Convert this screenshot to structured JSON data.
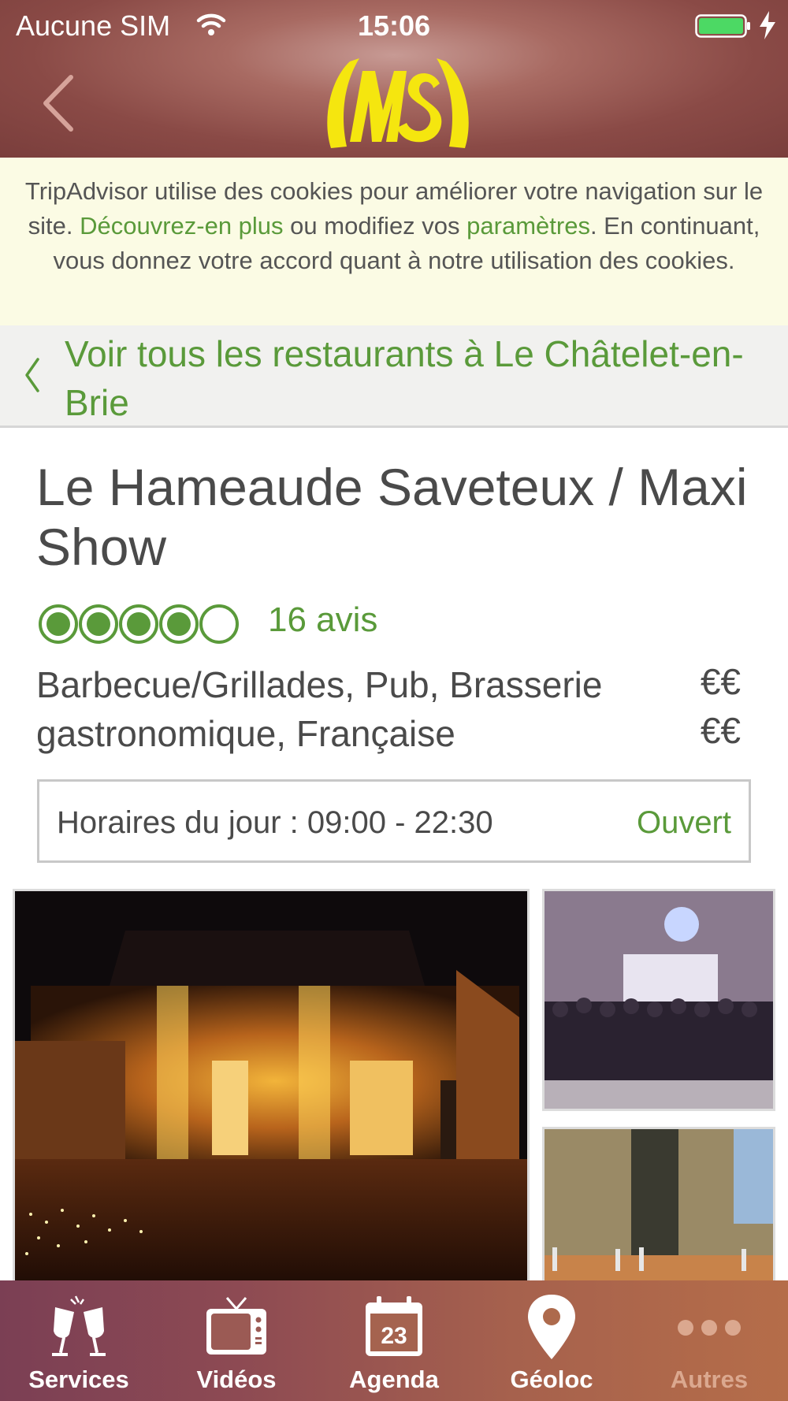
{
  "status": {
    "carrier": "Aucune SIM",
    "time": "15:06"
  },
  "nav": {
    "back_icon": "chevron-left-icon",
    "logo_text": "MS"
  },
  "cookie_banner": {
    "text_1": "TripAdvisor utilise des cookies pour améliorer votre navigation sur le site. ",
    "link_learn": "Découvrez-en plus",
    "text_2": " ou modifiez vos ",
    "link_settings": "paramètres",
    "text_3": ". En continuant, vous donnez votre accord quant à notre utilisation des cookies."
  },
  "breadcrumb": {
    "label": "Voir tous les restaurants à Le Châtelet-en-Brie"
  },
  "restaurant": {
    "name": "Le Hameaude Saveteux / Maxi Show",
    "rating": 4,
    "rating_max": 5,
    "reviews": "16 avis",
    "cuisine": "Barbecue/Grillades, Pub, Brasserie gastronomique, Française",
    "price_1": "€€",
    "price_2": "€€",
    "hours_label": "Horaires du jour : 09:00 - 22:30",
    "open_status": "Ouvert"
  },
  "colors": {
    "accent_green": "#5a9a3a",
    "logo_yellow": "#f5e60f"
  },
  "tabbar": {
    "tabs": [
      {
        "label": "Services",
        "icon": "toast-glasses-icon"
      },
      {
        "label": "Vidéos",
        "icon": "tv-icon"
      },
      {
        "label": "Agenda",
        "icon": "calendar-icon",
        "badge": "23"
      },
      {
        "label": "Géoloc",
        "icon": "location-pin-icon"
      },
      {
        "label": "Autres",
        "icon": "more-dots-icon"
      }
    ]
  }
}
